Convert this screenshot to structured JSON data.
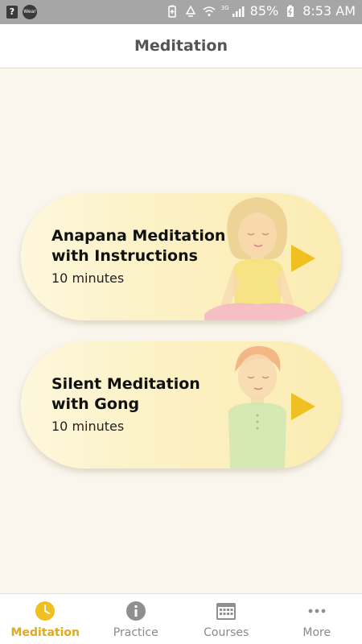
{
  "status_bar": {
    "left_icons": [
      "help-box-icon",
      "wear-icon"
    ],
    "wear_label": "Wear",
    "right_icons": [
      "battery-saver-icon",
      "recycle-icon",
      "wifi-icon",
      "signal-icon",
      "battery-icon"
    ],
    "network": "3G",
    "battery": "85%",
    "time": "8:53 AM"
  },
  "header": {
    "title": "Meditation"
  },
  "cards": [
    {
      "title_line1": "Anapana Meditation",
      "title_line2": "with Instructions",
      "duration": "10 minutes",
      "icon": "play-icon"
    },
    {
      "title_line1": "Silent Meditation",
      "title_line2": "with Gong",
      "duration": "10 minutes",
      "icon": "play-icon"
    }
  ],
  "nav": {
    "active": "Meditation",
    "accent_color": "#e0a91e",
    "inactive_color": "#8a8a8a",
    "items": [
      {
        "label": "Meditation",
        "icon": "clock-icon"
      },
      {
        "label": "Practice",
        "icon": "info-icon"
      },
      {
        "label": "Courses",
        "icon": "calendar-icon"
      },
      {
        "label": "More",
        "icon": "more-icon"
      }
    ]
  },
  "colors": {
    "background": "#faf6ee",
    "play": "#f0c020"
  }
}
